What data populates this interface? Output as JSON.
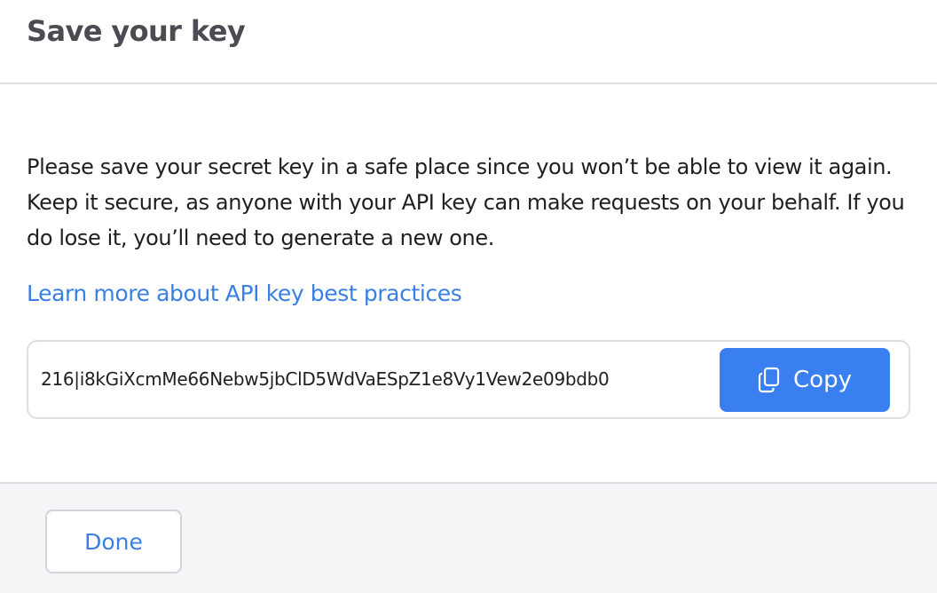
{
  "modal": {
    "title": "Save your key",
    "description": "Please save your secret key in a safe place since you won’t be able to view it again. Keep it secure, as anyone with your API key can make requests on your behalf. If you do lose it, you’ll need to generate a new one.",
    "learn_more_link": "Learn more about API key best practices",
    "api_key": "216|i8kGiXcmMe66Nebw5jbClD5WdVaESpZ1e8Vy1Vew2e09bdb0",
    "copy_button": {
      "label": "Copy",
      "icon": "copy-icon"
    },
    "done_button": "Done"
  },
  "colors": {
    "accent": "#3a7ff0",
    "link": "#3a7fe6",
    "title": "#4b4b52",
    "text": "#1f1f23",
    "border": "#dedee2",
    "footer_background": "#f5f5f8"
  }
}
